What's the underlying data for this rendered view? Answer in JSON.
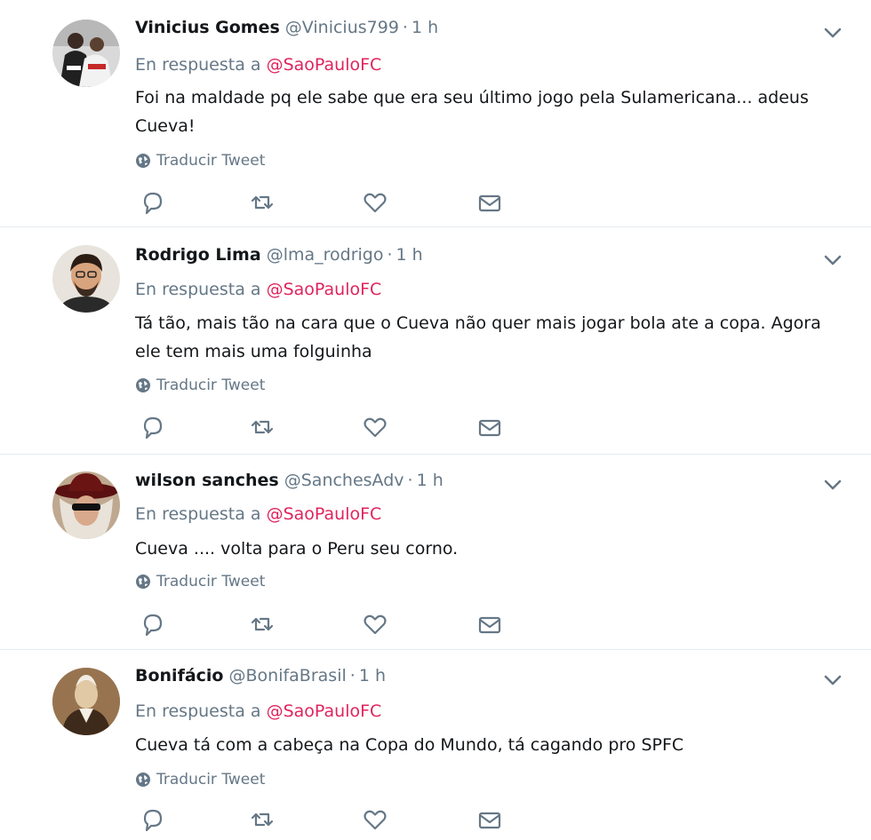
{
  "colors": {
    "text": "#14171a",
    "muted": "#657786",
    "mention": "#e0245e",
    "divider": "#e6ecf0"
  },
  "icons": {
    "reply": "reply-icon",
    "retweet": "retweet-icon",
    "like": "heart-icon",
    "dm": "mail-icon",
    "more": "chevron-down-icon",
    "translate": "globe-icon"
  },
  "tweets": [
    {
      "name": "Vinicius Gomes",
      "handle": "@Vinicius799",
      "separator": "·",
      "time": "1 h",
      "reply_prefix": "En respuesta a",
      "reply_to": "@SaoPauloFC",
      "text": "Foi na maldade pq ele sabe que era seu último jogo pela Sulamericana... adeus Cueva!",
      "translate": "Traducir Tweet"
    },
    {
      "name": "Rodrigo Lima",
      "handle": "@lma_rodrigo",
      "separator": "·",
      "time": "1 h",
      "reply_prefix": "En respuesta a",
      "reply_to": "@SaoPauloFC",
      "text": "Tá tão, mais tão na cara que o Cueva não quer mais jogar bola ate a copa. Agora ele tem mais uma folguinha",
      "translate": "Traducir Tweet"
    },
    {
      "name": "wilson sanches",
      "handle": "@SanchesAdv",
      "separator": "·",
      "time": "1 h",
      "reply_prefix": "En respuesta a",
      "reply_to": "@SaoPauloFC",
      "text": "Cueva .... volta para o Peru seu corno.",
      "translate": "Traducir Tweet"
    },
    {
      "name": "Bonifácio",
      "handle": "@BonifaBrasil",
      "separator": "·",
      "time": "1 h",
      "reply_prefix": "En respuesta a",
      "reply_to": "@SaoPauloFC",
      "text": "Cueva tá com a cabeça na Copa do Mundo, tá cagando pro SPFC",
      "translate": "Traducir Tweet"
    }
  ]
}
